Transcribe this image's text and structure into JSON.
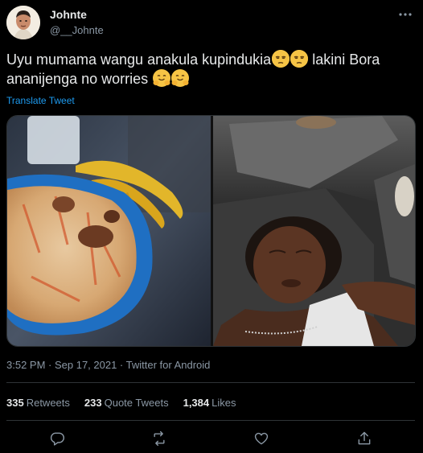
{
  "author": {
    "display_name": "Johnte",
    "handle": "@__Johnte",
    "avatar_icon": "avatar-icon"
  },
  "tweet": {
    "text_part1": "Uyu mumama wangu anakula kupindukia",
    "text_part2": " lakini Bora ananijenga no worries ",
    "emojis": [
      "unamused-face-emoji",
      "unamused-face-emoji",
      "hugging-face-emoji",
      "hugging-face-emoji"
    ],
    "translate_label": "Translate Tweet"
  },
  "media": {
    "images": [
      {
        "name": "pilau-and-bananas-photo"
      },
      {
        "name": "sleeping-woman-photo"
      }
    ]
  },
  "meta": {
    "timestamp": "3:52 PM · Sep 17, 2021 · Twitter for Android"
  },
  "stats": {
    "retweets_count": "335",
    "retweets_label": "Retweets",
    "quotes_count": "233",
    "quotes_label": "Quote Tweets",
    "likes_count": "1,384",
    "likes_label": "Likes"
  },
  "actions": [
    "reply-icon",
    "retweet-icon",
    "like-icon",
    "share-icon"
  ],
  "colors": {
    "background": "#000000",
    "text": "#e7e9ea",
    "muted": "#8b98a5",
    "link": "#1d9bf0",
    "divider": "#2f3336"
  }
}
